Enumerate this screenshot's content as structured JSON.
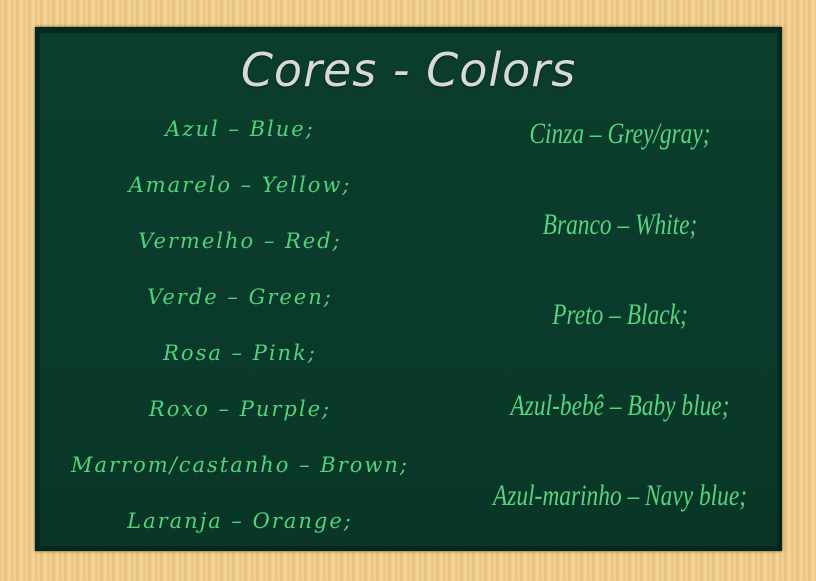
{
  "title": "Cores - Colors",
  "left": [
    "Azul – Blue;",
    "Amarelo – Yellow;",
    "Vermelho – Red;",
    "Verde – Green;",
    "Rosa – Pink;",
    "Roxo – Purple;",
    "Marrom/castanho – Brown;",
    "Laranja – Orange;"
  ],
  "right": [
    "Cinza – Grey/gray;",
    "Branco – White;",
    "Preto – Black;",
    "Azul-bebê – Baby blue;",
    "Azul-marinho – Navy blue;"
  ],
  "colors": {
    "board": "#0a3a2b",
    "text": "#52d27a",
    "title": "#d8d8d8"
  }
}
